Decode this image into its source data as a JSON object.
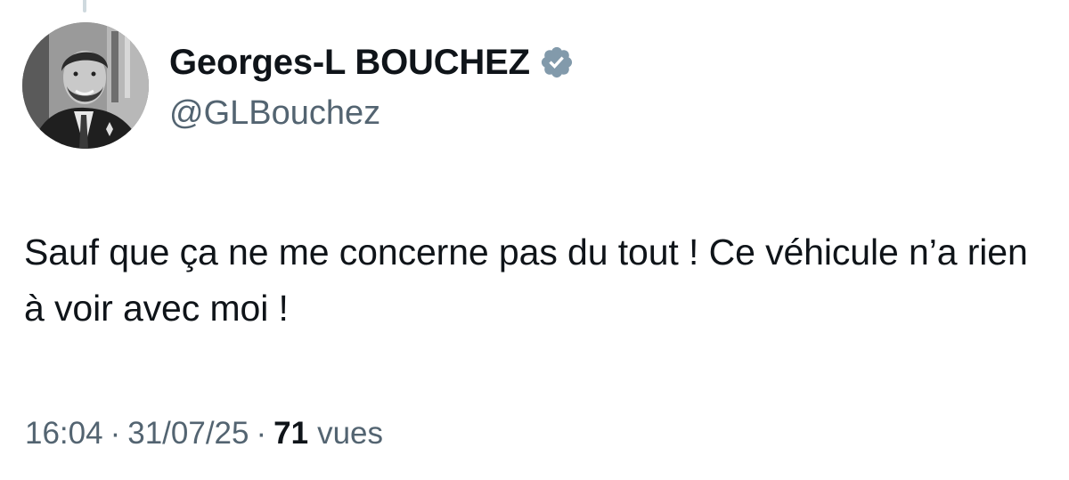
{
  "author": {
    "display_name": "Georges-L BOUCHEZ",
    "handle": "@GLBouchez",
    "verified": true,
    "verified_icon": "verified-badge-icon",
    "verified_color": "#829aab"
  },
  "tweet": {
    "text": "Sauf que ça ne me concerne pas du tout ! Ce véhicule n’a rien à voir avec moi !"
  },
  "meta": {
    "time": "16:04",
    "separator": "·",
    "date": "31/07/25",
    "views_count": "71",
    "views_label": "vues"
  },
  "colors": {
    "text_primary": "#0f1419",
    "text_secondary": "#536471",
    "thread_line": "#cfd9de"
  }
}
